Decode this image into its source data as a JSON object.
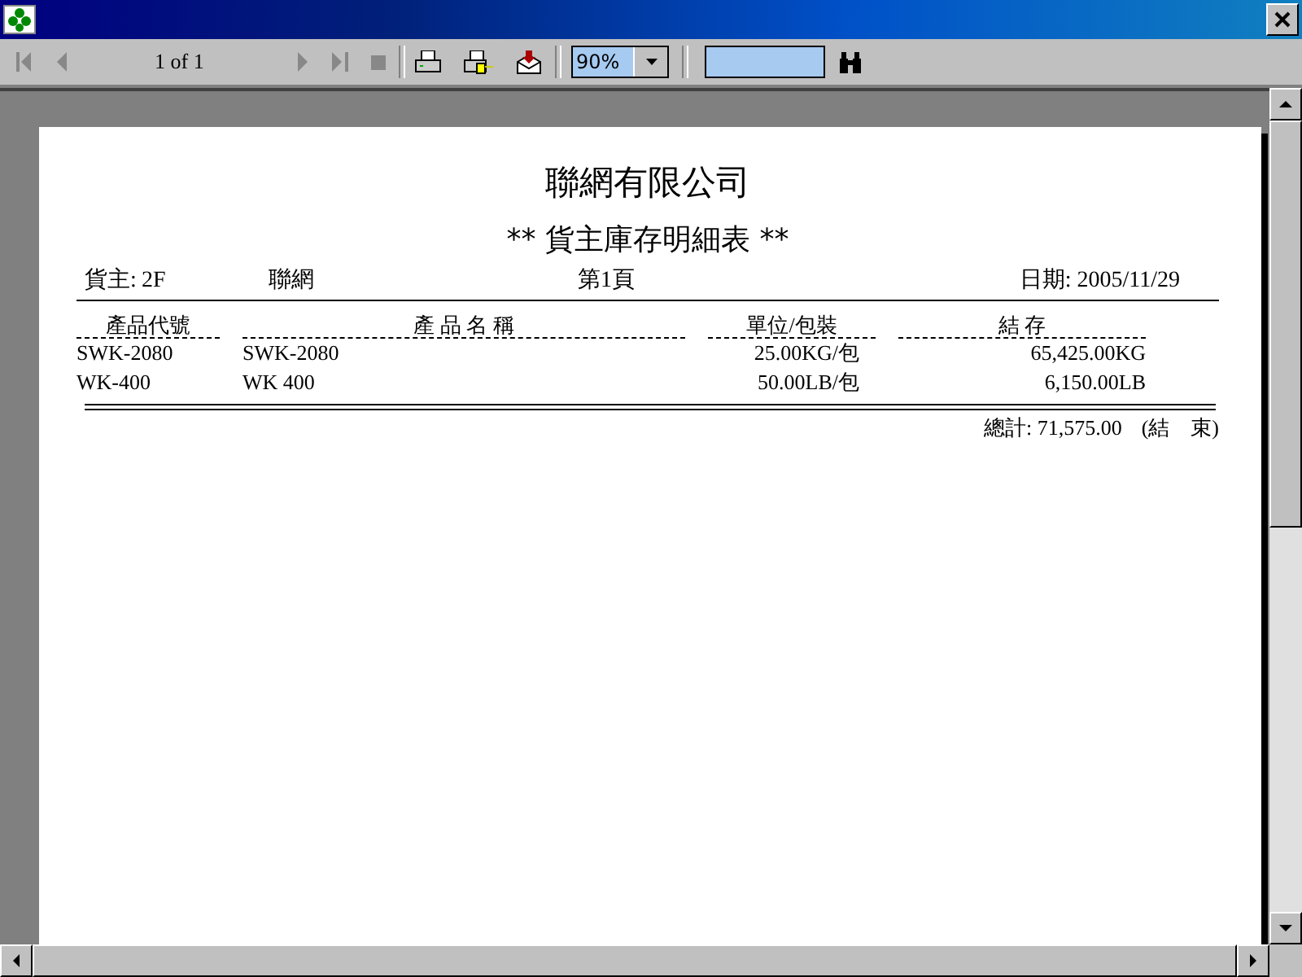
{
  "toolbar": {
    "page_indicator": "1 of 1",
    "zoom": "90%"
  },
  "report": {
    "company": "聯網有限公司",
    "title": "** 貨主庫存明細表 **",
    "owner_label": "貨主:",
    "owner_code": "2F",
    "owner_name": "聯網",
    "page": "第1頁",
    "date": "日期: 2005/11/29",
    "columns": [
      "產品代號",
      "產 品 名 稱",
      "單位/包裝",
      "結 存"
    ],
    "rows": [
      {
        "code": "SWK-2080",
        "name": "SWK-2080",
        "unit": "25.00KG/包",
        "stock": "65,425.00KG"
      },
      {
        "code": "WK-400",
        "name": "WK 400",
        "unit": "50.00LB/包",
        "stock": "6,150.00LB"
      }
    ],
    "total": "總計: 71,575.00",
    "end": "(結　束)"
  }
}
